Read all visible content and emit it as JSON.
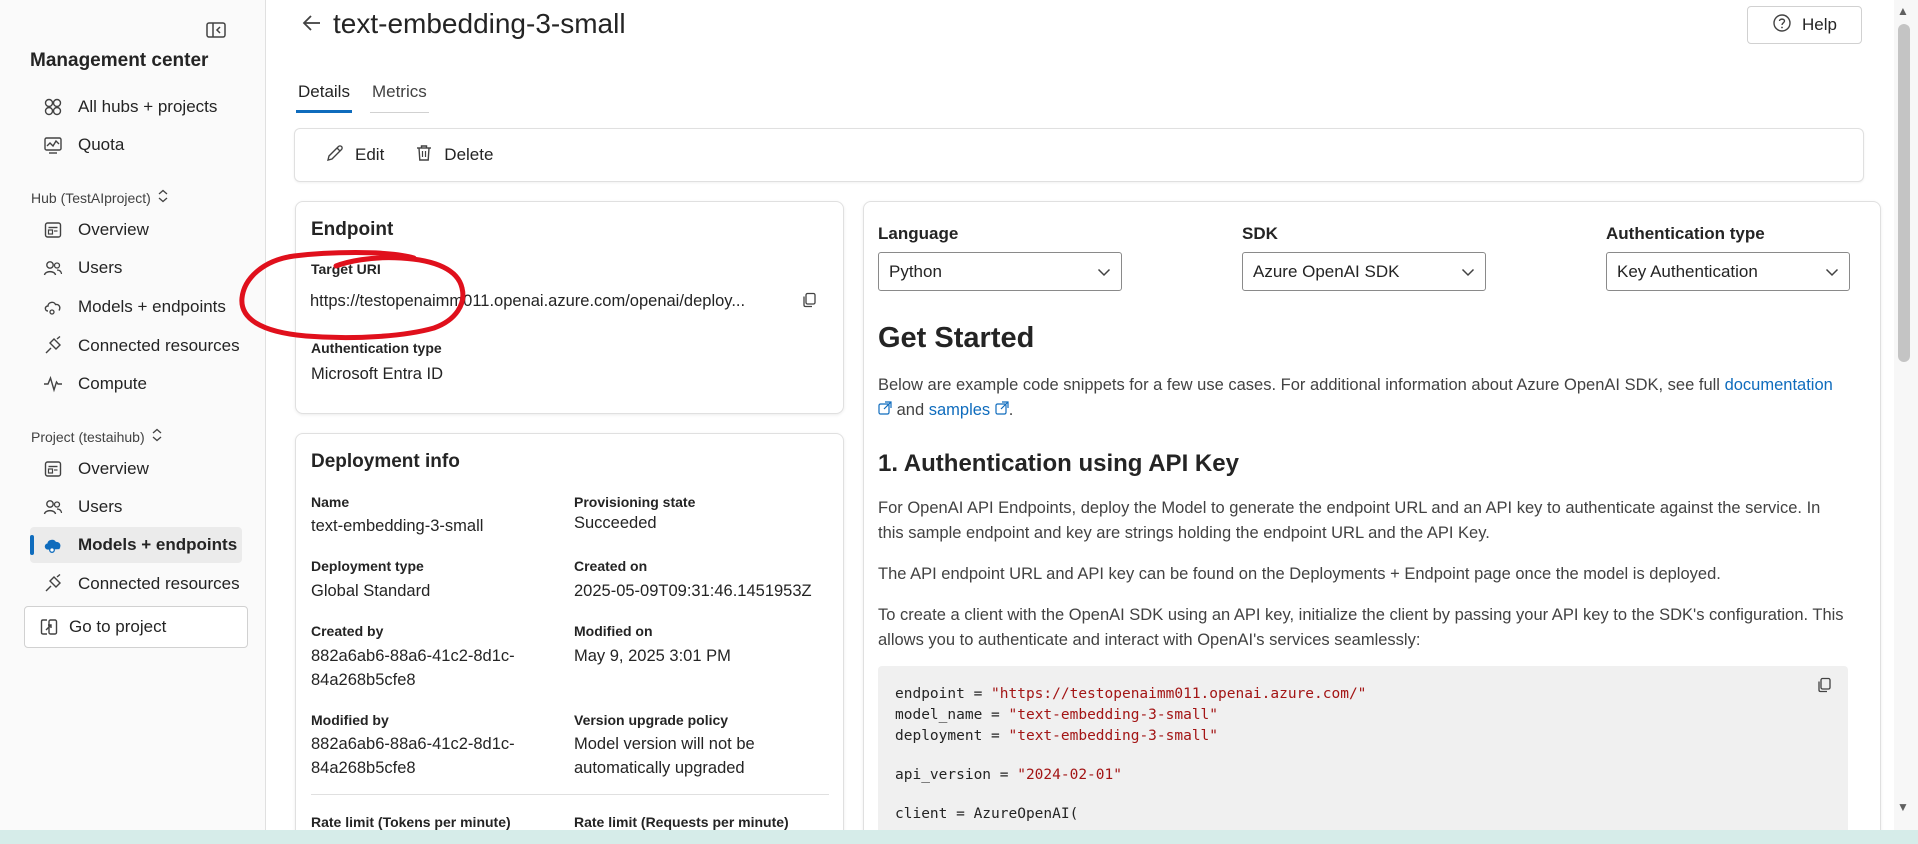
{
  "sidebar": {
    "title": "Management center",
    "top_items": [
      {
        "label": "All hubs + projects",
        "icon": "hubs-icon"
      },
      {
        "label": "Quota",
        "icon": "quota-icon"
      }
    ],
    "hub_section": {
      "label": "Hub (TestAIproject)",
      "items": [
        {
          "label": "Overview",
          "icon": "overview-icon"
        },
        {
          "label": "Users",
          "icon": "users-icon"
        },
        {
          "label": "Models + endpoints",
          "icon": "models-icon"
        },
        {
          "label": "Connected resources",
          "icon": "connected-icon"
        },
        {
          "label": "Compute",
          "icon": "compute-icon"
        }
      ]
    },
    "project_section": {
      "label": "Project (testaihub)",
      "items": [
        {
          "label": "Overview",
          "icon": "overview-icon"
        },
        {
          "label": "Users",
          "icon": "users-icon"
        },
        {
          "label": "Models + endpoints",
          "icon": "models-icon",
          "active": true
        },
        {
          "label": "Connected resources",
          "icon": "connected-icon"
        }
      ]
    },
    "go_to_project": "Go to project"
  },
  "header": {
    "title": "text-embedding-3-small",
    "help_label": "Help",
    "tabs": [
      {
        "label": "Details",
        "active": true
      },
      {
        "label": "Metrics",
        "active": false
      }
    ]
  },
  "toolbar": {
    "edit_label": "Edit",
    "delete_label": "Delete"
  },
  "endpoint": {
    "title": "Endpoint",
    "target_uri_label": "Target URI",
    "target_uri_value": "https://testopenaimm011.openai.azure.com/openai/deploy...",
    "auth_label": "Authentication type",
    "auth_value": "Microsoft Entra ID"
  },
  "deployment_info": {
    "title": "Deployment info",
    "name_label": "Name",
    "name_value": "text-embedding-3-small",
    "provisioning_label": "Provisioning state",
    "provisioning_value": "Succeeded",
    "type_label": "Deployment type",
    "type_value": "Global Standard",
    "created_on_label": "Created on",
    "created_on_value": "2025-05-09T09:31:46.1451953Z",
    "created_by_label": "Created by",
    "created_by_value_1": "882a6ab6-88a6-41c2-8d1c-",
    "created_by_value_2": "84a268b5cfe8",
    "modified_on_label": "Modified on",
    "modified_on_value": "May 9, 2025 3:01 PM",
    "modified_by_label": "Modified by",
    "modified_by_value_1": "882a6ab6-88a6-41c2-8d1c-",
    "modified_by_value_2": "84a268b5cfe8",
    "upgrade_label": "Version upgrade policy",
    "upgrade_value_1": "Model version will not be",
    "upgrade_value_2": "automatically upgraded",
    "rate_tokens_label": "Rate limit (Tokens per minute)",
    "rate_requests_label": "Rate limit (Requests per minute)"
  },
  "code_panel": {
    "language_label": "Language",
    "language_value": "Python",
    "sdk_label": "SDK",
    "sdk_value": "Azure OpenAI SDK",
    "auth_type_label": "Authentication type",
    "auth_type_value": "Key Authentication",
    "get_started_title": "Get Started",
    "intro_text": "Below are example code snippets for a few use cases. For additional information about Azure OpenAI SDK, see full",
    "documentation_link": "documentation",
    "and_text": "and",
    "samples_link": "samples",
    "period": ".",
    "section1_title": "1. Authentication using API Key",
    "para1": "For OpenAI API Endpoints, deploy the Model to generate the endpoint URL and an API key to authenticate against the service. In this sample endpoint and key are strings holding the endpoint URL and the API Key.",
    "para2": "The API endpoint URL and API key can be found on the Deployments + Endpoint page once the model is deployed.",
    "para3": "To create a client with the OpenAI SDK using an API key, initialize the client by passing your API key to the SDK's configuration. This allows you to authenticate and interact with OpenAI's services seamlessly:",
    "code": {
      "l1_var": "endpoint = ",
      "l1_str": "\"https://testopenaimm011.openai.azure.com/\"",
      "l2_var": "model_name = ",
      "l2_str": "\"text-embedding-3-small\"",
      "l3_var": "deployment = ",
      "l3_str": "\"text-embedding-3-small\"",
      "l4_var": "api_version = ",
      "l4_str": "\"2024-02-01\"",
      "l5": "client = AzureOpenAI("
    }
  },
  "colors": {
    "accent": "#0f6cbd",
    "annotation": "#e0101c",
    "code_string": "#a31515"
  }
}
